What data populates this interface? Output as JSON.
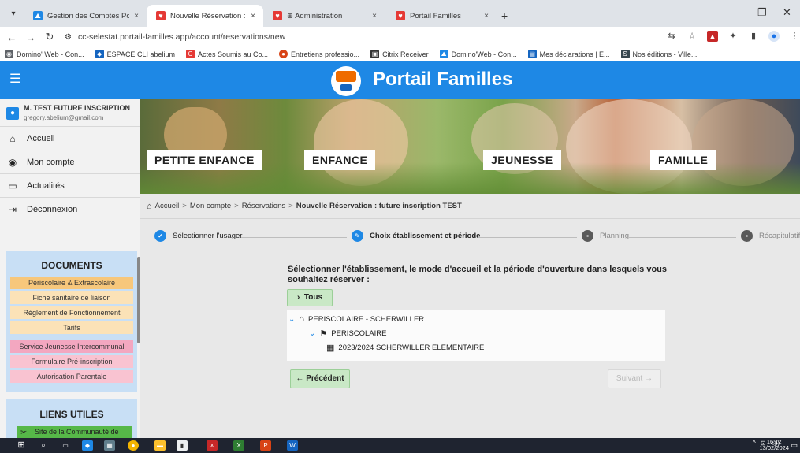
{
  "browser": {
    "tabs": [
      {
        "title": "Gestion des Comptes Portail",
        "favicon_color": "#1e88e5",
        "close": "×"
      },
      {
        "title": "Nouvelle Réservation : future i",
        "favicon_color": "#e53935",
        "close": "×"
      },
      {
        "title": "⊕ Administration",
        "favicon_color": "#e53935",
        "close": "×"
      },
      {
        "title": "Portail Familles",
        "favicon_color": "#e53935",
        "close": "×"
      }
    ],
    "new_tab": "+",
    "url": "cc-selestat.portail-familles.app/account/reservations/new",
    "bookmarks": [
      {
        "label": "Domino' Web - Con...",
        "color": "#5f6368"
      },
      {
        "label": "ESPACE CLI abelium",
        "color": "#1565c0"
      },
      {
        "label": "Actes Soumis au Co...",
        "color": "#e53935"
      },
      {
        "label": "Entretiens professio...",
        "color": "#d84315"
      },
      {
        "label": "Citrix Receiver",
        "color": "#333333"
      },
      {
        "label": "Domino'Web - Con...",
        "color": "#1e88e5"
      },
      {
        "label": "Mes déclarations | E...",
        "color": "#1565c0"
      },
      {
        "label": "Nos éditions - Ville...",
        "color": "#37474f"
      }
    ]
  },
  "app": {
    "title": "Portail Familles",
    "brand_color": "#1e88e5"
  },
  "sidebar": {
    "user_name": "M. TEST FUTURE INSCRIPTION",
    "user_email": "gregory.abelium@gmail.com",
    "menu": [
      {
        "label": "Accueil",
        "icon": "home-icon"
      },
      {
        "label": "Mon compte",
        "icon": "account-circle-icon"
      },
      {
        "label": "Actualités",
        "icon": "news-icon"
      },
      {
        "label": "Déconnexion",
        "icon": "logout-icon"
      }
    ],
    "documents_title": "DOCUMENTS",
    "documents": [
      "Périscolaire & Extrascolaire",
      "Fiche sanitaire de liaison",
      "Règlement de Fonctionnement",
      "Tarifs",
      "Service Jeunesse Intercommunal",
      "Formulaire Pré-inscription",
      "Autorisation Parentale"
    ],
    "links_title": "LIENS UTILES",
    "links": [
      "Site de la Communauté de"
    ]
  },
  "banner": {
    "categories": [
      "PETITE ENFANCE",
      "ENFANCE",
      "JEUNESSE",
      "FAMILLE"
    ]
  },
  "breadcrumb": {
    "items": [
      "Accueil",
      "Mon compte",
      "Réservations"
    ],
    "separator": ">",
    "current": "Nouvelle Réservation : future inscription TEST"
  },
  "stepper": {
    "steps": [
      {
        "label": "Sélectionner l'usager",
        "state": "done"
      },
      {
        "label": "Choix établissement et période",
        "state": "current"
      },
      {
        "label": "Planning",
        "state": "todo"
      },
      {
        "label": "Récapitulatif",
        "state": "todo"
      }
    ]
  },
  "main": {
    "question": "Sélectionner l'établissement, le mode d'accueil et la période d'ouverture dans lesquels vous souhaitez réserver :",
    "tous_button": "Tous",
    "tree": {
      "level1": "PERISCOLAIRE - SCHERWILLER",
      "level2": "PERISCOLAIRE",
      "level3": "2023/2024 SCHERWILLER ELEMENTAIRE"
    },
    "prev_button": "Précédent",
    "next_button": "Suivant"
  },
  "taskbar": {
    "time": "16:12",
    "date": "13/02/2024"
  }
}
